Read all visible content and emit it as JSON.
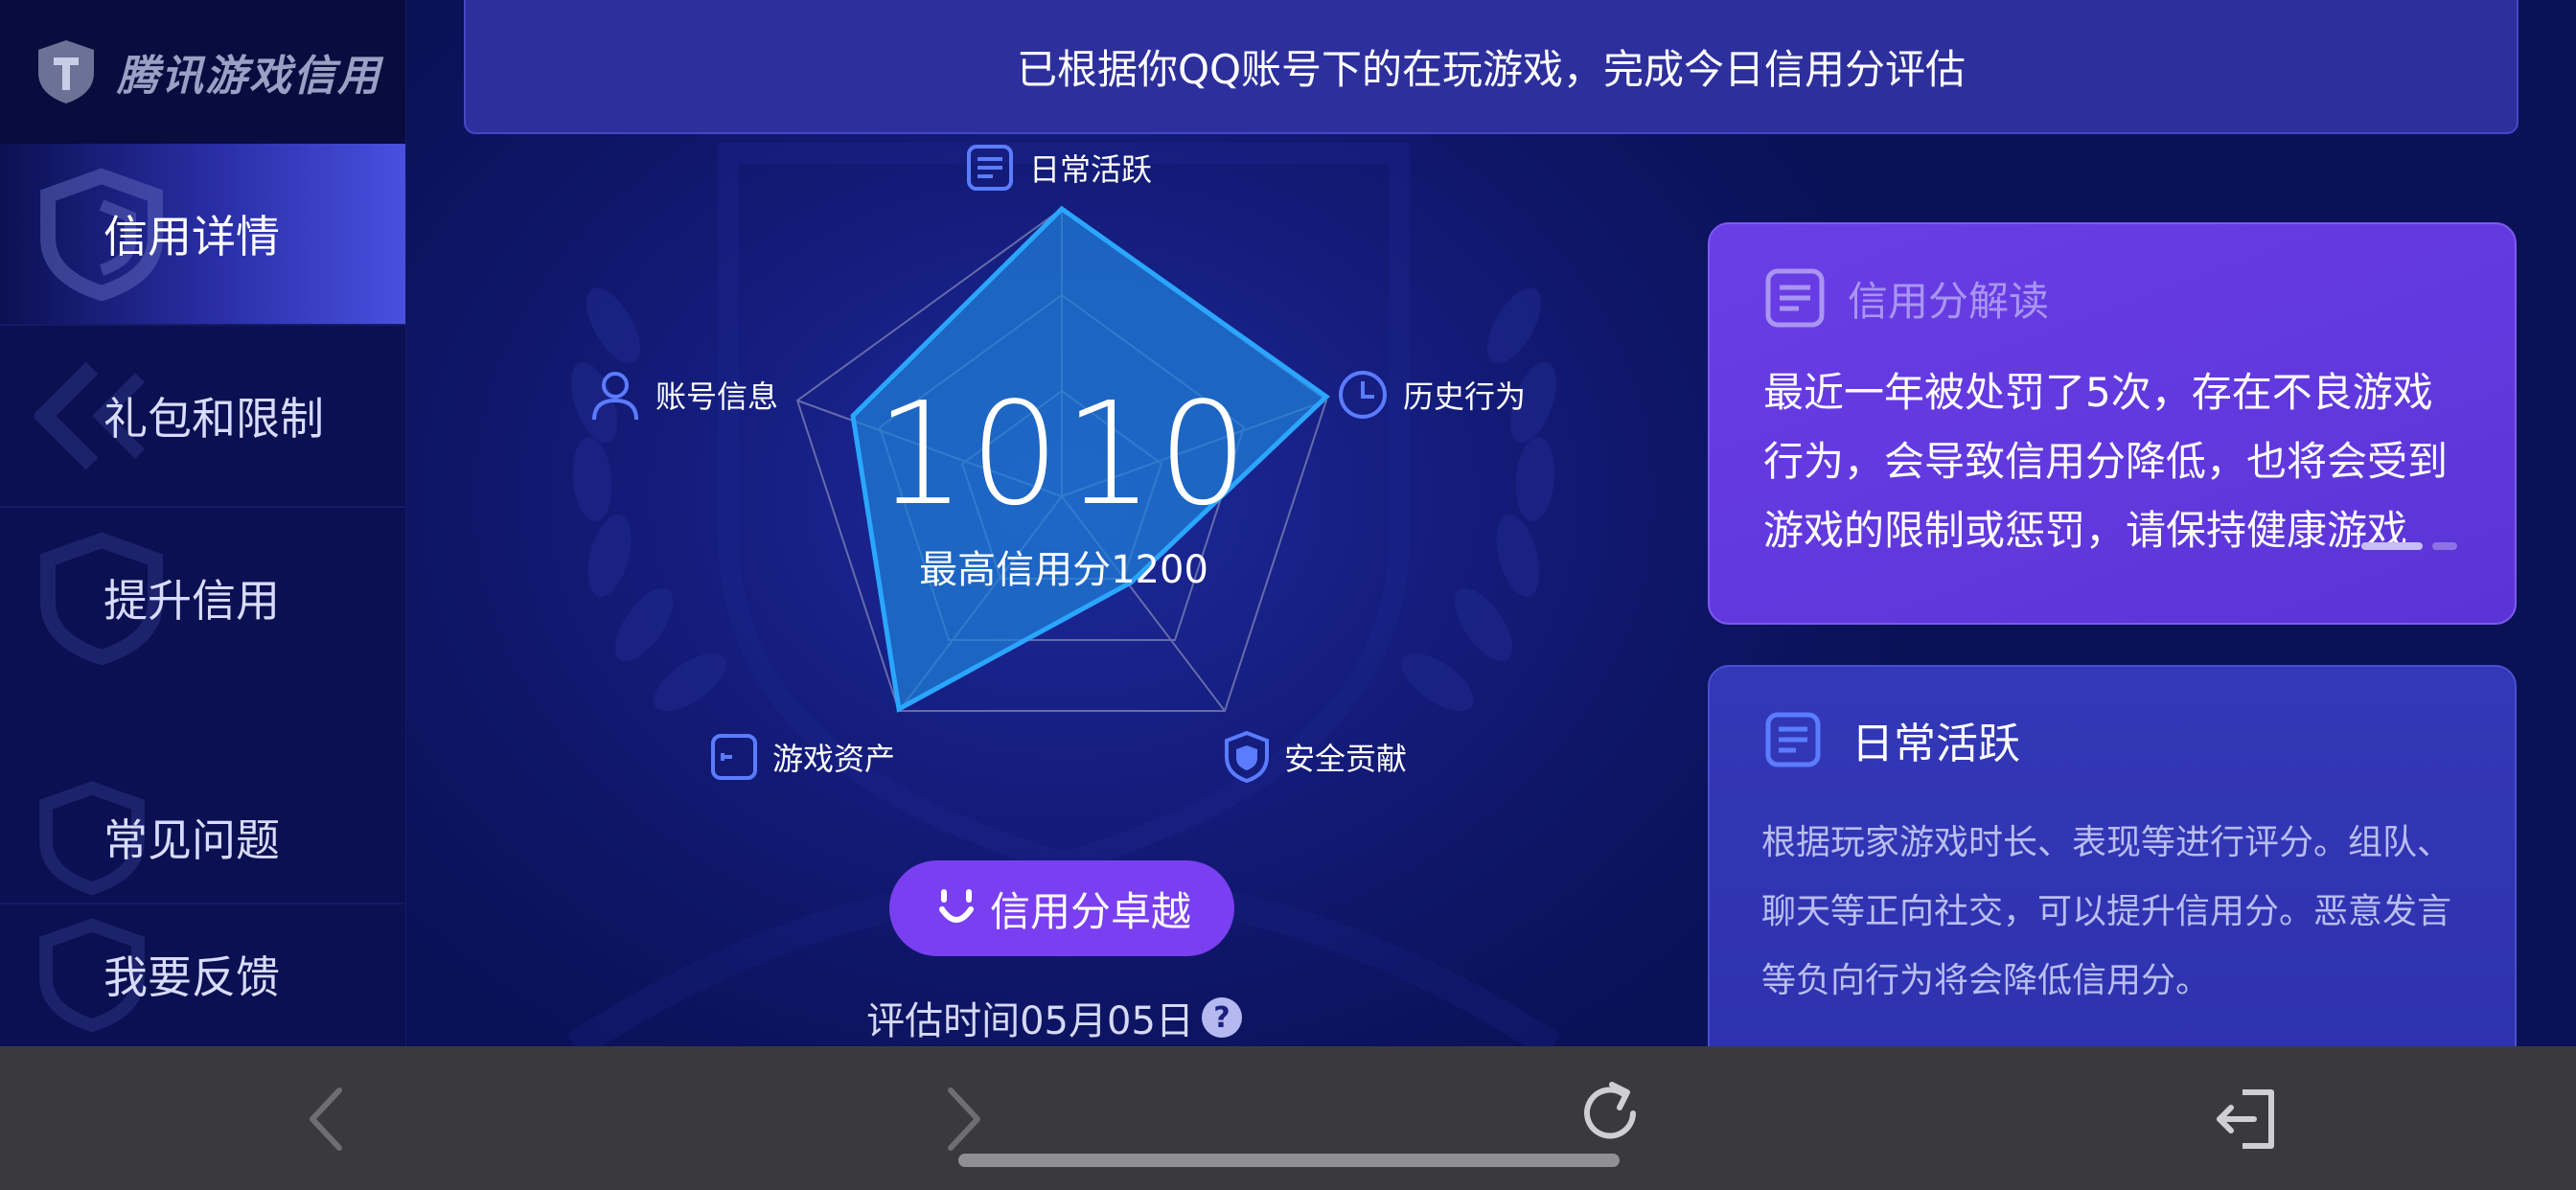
{
  "app": {
    "logo_text": "腾讯游戏信用"
  },
  "sidebar": {
    "items": [
      {
        "label": "信用详情",
        "active": true
      },
      {
        "label": "礼包和限制",
        "active": false
      },
      {
        "label": "提升信用",
        "active": false
      },
      {
        "label": "常见问题",
        "active": false
      },
      {
        "label": "我要反馈",
        "active": false
      }
    ]
  },
  "banner": {
    "text": "已根据你QQ账号下的在玩游戏，完成今日信用分评估"
  },
  "radar": {
    "axes": [
      "日常活跃",
      "历史行为",
      "安全贡献",
      "游戏资产",
      "账号信息"
    ],
    "score": "1010",
    "max_score_text": "最高信用分1200",
    "level_label": "信用分卓越",
    "eval_time": "评估时间05月05日",
    "help_glyph": "?"
  },
  "interpretation": {
    "title": "信用分解读",
    "lines": [
      "最近一年被处罚了5次，存在不良游戏",
      "行为，会导致信用分降低，也将会受到",
      "游戏的限制或惩罚，请保持健康游戏"
    ]
  },
  "daily": {
    "title": "日常活跃",
    "lines": [
      "根据玩家游戏时长、表现等进行评分。组队、",
      "聊天等正向社交，可以提升信用分。恶意发言",
      "等负向行为将会降低信用分。"
    ]
  },
  "colors": {
    "accent_purple": "#7a3ff0",
    "radar_fill": "#1e7fd8",
    "radar_stroke": "#2aa6ff",
    "icon_blue": "#5b7cff"
  },
  "icons": {
    "back": "chevron-left-icon",
    "forward": "chevron-right-icon",
    "reload": "reload-icon",
    "exit": "exit-icon"
  }
}
